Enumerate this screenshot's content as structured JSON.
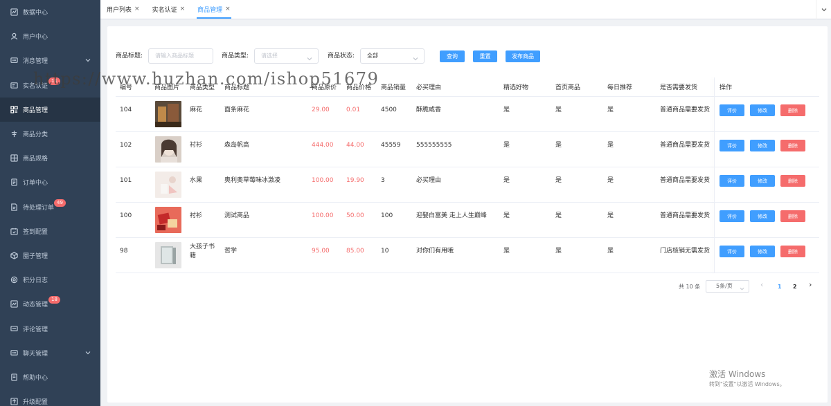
{
  "sidebar": {
    "items": [
      {
        "label": "数据中心",
        "icon": "chart-icon"
      },
      {
        "label": "用户中心",
        "icon": "user-icon"
      },
      {
        "label": "消息管理",
        "icon": "message-icon"
      },
      {
        "label": "实名认证",
        "icon": "idcard-icon",
        "badge": "11"
      },
      {
        "label": "商品管理",
        "icon": "goods-icon"
      },
      {
        "label": "商品分类",
        "icon": "category-icon"
      },
      {
        "label": "商品规格",
        "icon": "spec-icon"
      },
      {
        "label": "订单中心",
        "icon": "order-icon"
      },
      {
        "label": "待处理订单",
        "icon": "pending-order-icon",
        "badge": "49"
      },
      {
        "label": "签到配置",
        "icon": "signin-icon"
      },
      {
        "label": "圈子管理",
        "icon": "circle-icon"
      },
      {
        "label": "积分日志",
        "icon": "points-icon"
      },
      {
        "label": "动态管理",
        "icon": "dynamic-icon",
        "badge": "18"
      },
      {
        "label": "评论管理",
        "icon": "comment-icon"
      },
      {
        "label": "聊天管理",
        "icon": "chat-icon"
      },
      {
        "label": "帮助中心",
        "icon": "help-icon"
      },
      {
        "label": "升级配置",
        "icon": "upgrade-icon"
      }
    ]
  },
  "tabs": [
    {
      "label": "用户列表",
      "close": "×"
    },
    {
      "label": "实名认证",
      "close": "×"
    },
    {
      "label": "商品管理",
      "close": "×"
    }
  ],
  "filters": {
    "title_label": "商品标题:",
    "title_placeholder": "请输入商品标题",
    "type_label": "商品类型:",
    "type_placeholder": "请选择",
    "status_label": "商品状态:",
    "status_value": "全部",
    "search_button": "查询",
    "reset_button": "重置",
    "publish_button": "发布商品"
  },
  "table": {
    "headers": [
      "编号",
      "商品图片",
      "商品类型",
      "商品标题",
      "商品原价",
      "商品价格",
      "商品销量",
      "必买理由",
      "精选好物",
      "首页商品",
      "每日推荐",
      "是否需要发货",
      "操作"
    ],
    "rows": [
      {
        "id": "104",
        "type": "麻花",
        "title": "面条麻花",
        "orig": "29.00",
        "price": "0.01",
        "sales": "4500",
        "reason": "酥脆咸香",
        "featured": "是",
        "home": "是",
        "daily": "是",
        "ship": "普通商品需要发货"
      },
      {
        "id": "102",
        "type": "衬衫",
        "title": "森岛帆高",
        "orig": "444.00",
        "price": "44.00",
        "sales": "45559",
        "reason": "555555555",
        "featured": "是",
        "home": "是",
        "daily": "是",
        "ship": "普通商品需要发货"
      },
      {
        "id": "101",
        "type": "水果",
        "title": "奥利奥草莓味冰激凌",
        "orig": "100.00",
        "price": "19.90",
        "sales": "3",
        "reason": "必买理由",
        "featured": "是",
        "home": "是",
        "daily": "是",
        "ship": "普通商品需要发货"
      },
      {
        "id": "100",
        "type": "衬衫",
        "title": "测试商品",
        "orig": "100.00",
        "price": "50.00",
        "sales": "100",
        "reason": "迎娶白富美 走上人生巅峰",
        "featured": "是",
        "home": "是",
        "daily": "是",
        "ship": "普通商品需要发货"
      },
      {
        "id": "98",
        "type": "大孩子书籍",
        "title": "哲学",
        "orig": "95.00",
        "price": "85.00",
        "sales": "10",
        "reason": "对你们有用哦",
        "featured": "是",
        "home": "是",
        "daily": "是",
        "ship": "门店核销无需发货"
      }
    ],
    "actions": {
      "review": "评价",
      "edit": "修改",
      "delete": "删除"
    }
  },
  "pagination": {
    "total": "共 10 条",
    "page_size": "5条/页",
    "prev": "‹",
    "pages": [
      "1",
      "2"
    ],
    "next": "›"
  },
  "watermark": "https://www.huzhan.com/ishop51679",
  "activation": {
    "title": "激活 Windows",
    "subtitle": "转到\"设置\"以激活 Windows。"
  },
  "colors": {
    "sidebar_bg": "#304156",
    "primary": "#409eff",
    "danger": "#f56c6c"
  }
}
